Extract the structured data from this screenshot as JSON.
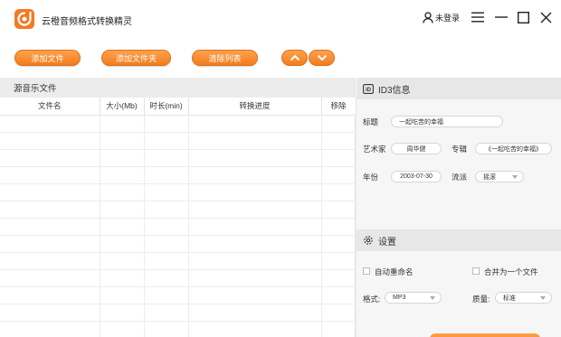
{
  "window": {
    "title": "云橙音频格式转换精灵",
    "user_label": "未登录"
  },
  "toolbar": {
    "add_file": "添加文件",
    "add_folder": "添加文件夹",
    "clear_list": "清除列表"
  },
  "file_list": {
    "panel_title": "源音乐文件",
    "columns": [
      "文件名",
      "大小(Mb)",
      "时长(min)",
      "转换进度",
      "移除"
    ],
    "rows": []
  },
  "id3": {
    "section_title": "ID3信息",
    "title_label": "标题",
    "title_value": "一起吃苦的幸福",
    "artist_label": "艺术家",
    "artist_value": "周华健",
    "album_label": "专辑",
    "album_value": "《一起吃苦的幸福》",
    "year_label": "年份",
    "year_value": "2003-07-30",
    "genre_label": "流派",
    "genre_value": "摇滚"
  },
  "settings": {
    "section_title": "设置",
    "auto_rename": "自动重命名",
    "auto_rename_checked": false,
    "merge_files": "合并为一个文件",
    "merge_files_checked": false,
    "format_label": "格式:",
    "format_value": "MP3",
    "quality_label": "质量:",
    "quality_value": "标准"
  },
  "colors": {
    "accent": "#f47a25",
    "panel_header": "#ececec"
  }
}
